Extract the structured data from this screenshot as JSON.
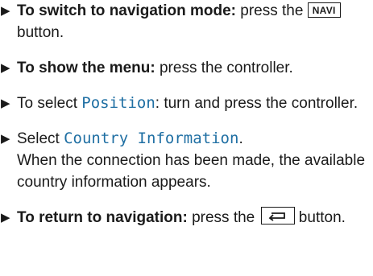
{
  "steps": [
    {
      "bold": "To switch to navigation mode:",
      "text_before_key": " press the ",
      "key_label": "NAVI",
      "text_after_key": " button."
    },
    {
      "bold": "To show the menu:",
      "text": " press the controller."
    },
    {
      "text_before": "To select ",
      "term": "Position",
      "text_after": ": turn and press the controller."
    },
    {
      "text_before": "Select ",
      "term": "Country Information",
      "text_after": ".",
      "continuation": "When the connection has been made, the available country information appears."
    },
    {
      "bold": "To return to navigation:",
      "text_before_key": " press the ",
      "key_icon": "back-arrow-icon",
      "text_after_key": " button."
    }
  ],
  "colors": {
    "text": "#1a1a1a",
    "term": "#1f6fa3"
  }
}
